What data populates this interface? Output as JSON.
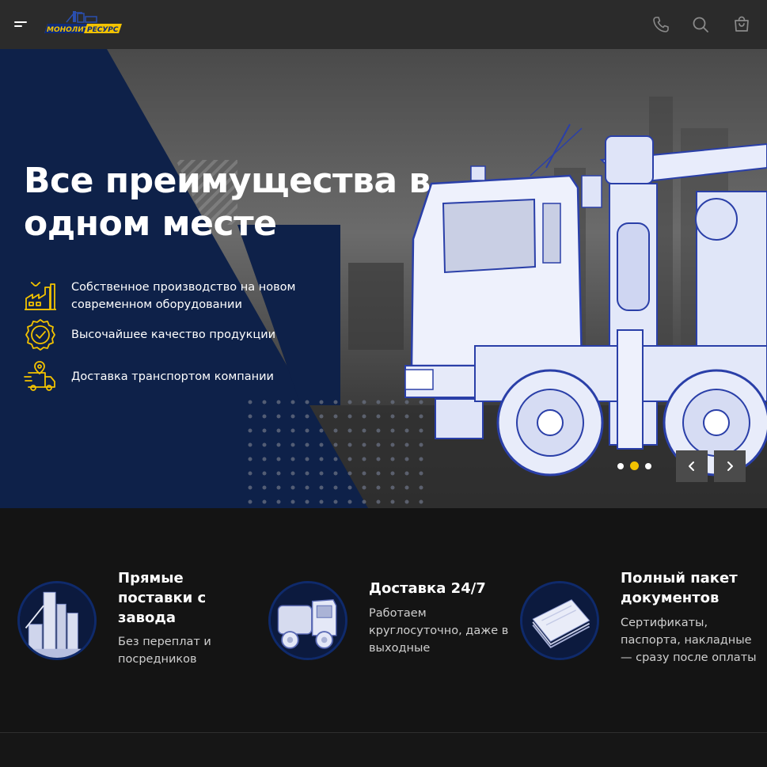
{
  "brand": {
    "logo_text": "МОНОЛИТ РЕСУРС",
    "accent": "#f2c200",
    "navy": "#0e2149"
  },
  "header": {
    "menu_icon": "menu-icon",
    "icons": [
      "phone-icon",
      "search-icon",
      "cart-icon"
    ]
  },
  "hero": {
    "title": "Все преимущества в одном месте",
    "features": [
      {
        "icon": "factory-icon",
        "text": "Собственное производство на новом современном оборудовании"
      },
      {
        "icon": "quality-badge-icon",
        "text": "Высочайшее качество продукции"
      },
      {
        "icon": "delivery-truck-icon",
        "text": "Доставка транспортом компании"
      }
    ],
    "slider": {
      "slides": 3,
      "active": 2
    }
  },
  "benefits": [
    {
      "image": "factory-image",
      "title": "Прямые поставки с завода",
      "desc": "Без переплат и посредников"
    },
    {
      "image": "truck-image",
      "title": "Доставка 24/7",
      "desc": "Работаем круглосуточно, даже в выходные"
    },
    {
      "image": "documents-image",
      "title": "Полный пакет документов",
      "desc": "Сертификаты, паспорта, накладные — сразу после оплаты"
    }
  ]
}
